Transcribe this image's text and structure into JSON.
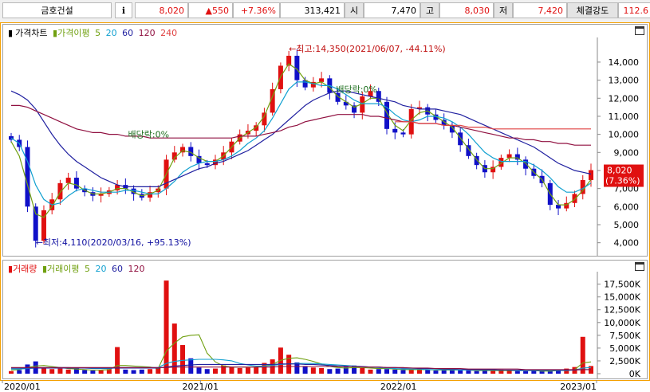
{
  "header": {
    "name": "금호건설",
    "info": "i",
    "price": "8,020",
    "change": "▲550",
    "change_pct": "+7.36%",
    "volume": "313,421",
    "open_label": "시",
    "open": "7,470",
    "high_label": "고",
    "high": "8,030",
    "low_label": "저",
    "low": "7,420",
    "strength_label": "체결강도",
    "strength": "112.6"
  },
  "price_legend": {
    "title": "가격차트",
    "ma_label": "가격이평",
    "ma5": "5",
    "ma20": "20",
    "ma60": "60",
    "ma120": "120",
    "ma240": "240"
  },
  "volume_legend": {
    "title": "거래량",
    "ma_label": "거래이평",
    "ma5": "5",
    "ma20": "20",
    "ma60": "60",
    "ma120": "120"
  },
  "colors": {
    "up": "#e01010",
    "down": "#1010c8",
    "ma5": "#70a010",
    "ma20": "#10a0d0",
    "ma60": "#2020a0",
    "ma120": "#901040",
    "ma240": "#e04040",
    "frame": "#f5a000"
  },
  "chart_data": {
    "type": "candlestick",
    "x_ticks": [
      "2020/01",
      "2021/01",
      "2022/01",
      "2023/01"
    ],
    "price_axis": {
      "ticks": [
        "4,000",
        "5,000",
        "6,000",
        "7,000",
        "8,000",
        "9,000",
        "10,000",
        "11,000",
        "12,000",
        "13,000",
        "14,000"
      ],
      "ylim": [
        3500,
        15100
      ]
    },
    "volume_axis": {
      "ticks": [
        "0K",
        "2,500K",
        "5,000K",
        "7,500K",
        "10,000K",
        "12,500K",
        "15,000K",
        "17,500K"
      ],
      "ylim": [
        0,
        19000
      ]
    },
    "annotations": {
      "high": "최고:14,350(2021/06/07, -44.11%)",
      "low": "최저:4,110(2020/03/16, +95.13%)",
      "dividend1": "배당락:0%",
      "dividend2": "배당락:0%",
      "current_price": "8,020",
      "current_pct": "(7.36%)"
    },
    "series": [
      {
        "name": "가격차트",
        "values": [
          9700,
          9300,
          6000,
          4110,
          5800,
          6400,
          7300,
          7600,
          7000,
          6800,
          6600,
          6700,
          6900,
          7200,
          7000,
          6700,
          6500,
          6800,
          7000,
          8600,
          9000,
          9300,
          8800,
          8400,
          8300,
          8600,
          9000,
          9600,
          10000,
          10200,
          10500,
          11200,
          12500,
          13800,
          14350,
          13000,
          12600,
          12900,
          13100,
          12300,
          11800,
          11600,
          11200,
          12100,
          12400,
          11800,
          10300,
          10100,
          10000,
          11400,
          11500,
          11100,
          10800,
          10500,
          10100,
          9400,
          8800,
          8300,
          7900,
          8200,
          8700,
          8900,
          8600,
          8100,
          7700,
          7300,
          6100,
          5900,
          6200,
          6700,
          7470,
          8020
        ]
      },
      {
        "name": "5",
        "values": [
          9600,
          8800,
          7200,
          5600,
          5400,
          6000,
          6800,
          7300,
          7200,
          6900,
          6700,
          6700,
          6800,
          7000,
          7000,
          6800,
          6600,
          6700,
          6900,
          7800,
          8700,
          9100,
          9000,
          8700,
          8500,
          8500,
          8800,
          9300,
          9800,
          10100,
          10400,
          11000,
          12100,
          13200,
          13900,
          13600,
          13000,
          12800,
          12900,
          12600,
          12100,
          11800,
          11500,
          11700,
          12000,
          12000,
          11200,
          10500,
          10200,
          10800,
          11200,
          11300,
          11000,
          10700,
          10400,
          9800,
          9200,
          8600,
          8100,
          8100,
          8400,
          8700,
          8700,
          8400,
          7900,
          7500,
          6700,
          6100,
          6100,
          6400,
          6900,
          7500
        ]
      },
      {
        "name": "20",
        "values": [
          9800,
          9500,
          8500,
          7200,
          6400,
          6100,
          6200,
          6600,
          6900,
          7000,
          6900,
          6800,
          6800,
          6800,
          6900,
          6900,
          6800,
          6700,
          6700,
          7000,
          7400,
          7900,
          8200,
          8400,
          8500,
          8500,
          8600,
          8800,
          9100,
          9500,
          9800,
          10200,
          10900,
          11700,
          12500,
          12900,
          12900,
          12800,
          12700,
          12700,
          12500,
          12200,
          11900,
          11700,
          11700,
          11700,
          11500,
          11100,
          10800,
          10700,
          10800,
          11000,
          11000,
          10900,
          10700,
          10400,
          10000,
          9500,
          9000,
          8700,
          8500,
          8500,
          8500,
          8500,
          8300,
          8000,
          7600,
          7100,
          6800,
          6800,
          7000,
          7300
        ]
      },
      {
        "name": "60",
        "values": [
          12400,
          12200,
          11900,
          11400,
          10700,
          10000,
          9400,
          8900,
          8500,
          8200,
          7900,
          7600,
          7400,
          7200,
          7100,
          7100,
          7100,
          7100,
          7100,
          7300,
          7500,
          7700,
          7900,
          8100,
          8200,
          8400,
          8500,
          8700,
          8900,
          9100,
          9400,
          9700,
          10000,
          10400,
          10800,
          11200,
          11600,
          11900,
          12100,
          12300,
          12400,
          12400,
          12300,
          12200,
          12100,
          12000,
          11900,
          11800,
          11600,
          11500,
          11400,
          11400,
          11400,
          11300,
          11200,
          11100,
          10900,
          10700,
          10500,
          10300,
          10100,
          9900,
          9700,
          9500,
          9300,
          9000,
          8700,
          8400,
          8200,
          8000,
          7900,
          7800
        ]
      },
      {
        "name": "120",
        "values": [
          11600,
          11600,
          11500,
          11300,
          11100,
          10900,
          10700,
          10500,
          10300,
          10200,
          10100,
          10100,
          10000,
          10000,
          9900,
          9900,
          9900,
          9800,
          9800,
          9800,
          9800,
          9800,
          9800,
          9800,
          9800,
          9800,
          9800,
          9800,
          9900,
          9900,
          9900,
          10000,
          10100,
          10200,
          10400,
          10500,
          10700,
          10800,
          10900,
          11000,
          11100,
          11100,
          11100,
          11100,
          11000,
          11000,
          10900,
          10800,
          10700,
          10700,
          10600,
          10600,
          10600,
          10500,
          10500,
          10400,
          10300,
          10200,
          10100,
          10000,
          9900,
          9800,
          9800,
          9700,
          9700,
          9600,
          9600,
          9500,
          9500,
          9400,
          9400,
          9400
        ]
      },
      {
        "name": "240",
        "values": [
          10700,
          10700,
          10700,
          10600,
          10600,
          10600,
          10500,
          10500,
          10500,
          10400,
          10400,
          10400,
          10300,
          10300,
          10300,
          10300,
          10300,
          10300,
          10300,
          10300,
          10300,
          10300,
          10300,
          10300,
          10300
        ]
      }
    ],
    "volume_values_k": [
      500,
      700,
      1800,
      2400,
      1200,
      900,
      1000,
      800,
      1000,
      700,
      600,
      650,
      900,
      5200,
      800,
      700,
      800,
      900,
      1200,
      18200,
      9800,
      5600,
      3000,
      1200,
      900,
      1000,
      1600,
      1300,
      1100,
      1200,
      1300,
      2100,
      2800,
      5100,
      3700,
      2200,
      1500,
      1200,
      1100,
      900,
      1000,
      1300,
      1600,
      1100,
      800,
      900,
      900,
      800,
      700,
      900,
      800,
      700,
      600,
      700,
      800,
      700,
      600,
      500,
      600,
      700,
      800,
      600,
      500,
      500,
      600,
      500,
      600,
      700,
      1000,
      1300,
      7200,
      1500
    ],
    "volume_ma_k": [
      {
        "name": "5",
        "values": [
          700,
          800,
          1200,
          1500,
          1600,
          1400,
          1200,
          1000,
          900,
          800,
          700,
          700,
          800,
          1600,
          1600,
          1500,
          1400,
          1300,
          1000,
          4400,
          6000,
          7200,
          7500,
          7600,
          4000,
          2300,
          1500,
          1300,
          1300,
          1300,
          1300,
          1500,
          1800,
          2600,
          3000,
          3100,
          2800,
          2400,
          1900,
          1400,
          1200,
          1100,
          1200,
          1200,
          1100,
          1000,
          1000,
          900,
          800,
          800,
          800,
          800,
          700,
          700,
          700,
          700,
          700,
          600,
          600,
          600,
          600,
          600,
          600,
          600,
          600,
          500,
          500,
          600,
          700,
          800,
          2100,
          2300
        ]
      },
      {
        "name": "20",
        "values": [
          900,
          900,
          1000,
          1100,
          1200,
          1200,
          1200,
          1200,
          1100,
          1100,
          1000,
          1000,
          1000,
          1200,
          1200,
          1200,
          1200,
          1200,
          1200,
          2000,
          2400,
          2600,
          2700,
          2800,
          2800,
          2800,
          2700,
          2500,
          2000,
          1700,
          1500,
          1500,
          1600,
          1800,
          1900,
          2000,
          2000,
          2000,
          1900,
          1800,
          1700,
          1600,
          1500,
          1400,
          1300,
          1200,
          1100,
          1000,
          900,
          900,
          900,
          800,
          800,
          800,
          800,
          700,
          700,
          700,
          700,
          700,
          700,
          700,
          600,
          600,
          600,
          600,
          600,
          600,
          600,
          700,
          1100,
          1200
        ]
      },
      {
        "name": "60",
        "values": [
          1100,
          1100,
          1100,
          1100,
          1100,
          1100,
          1100,
          1100,
          1100,
          1100,
          1100,
          1100,
          1100,
          1100,
          1100,
          1100,
          1100,
          1100,
          1100,
          1300,
          1500,
          1600,
          1700,
          1800,
          1800,
          1800,
          1800,
          1800,
          1800,
          1800,
          1800,
          1800,
          1800,
          1900,
          1900,
          1900,
          1800,
          1800,
          1700,
          1600,
          1500,
          1500,
          1400,
          1400,
          1300,
          1300,
          1200,
          1200,
          1100,
          1100,
          1000,
          1000,
          1000,
          900,
          900,
          900,
          800,
          800,
          800,
          800,
          700,
          700,
          700,
          700,
          700,
          700,
          700,
          700,
          700,
          700,
          800,
          800
        ]
      },
      {
        "name": "120",
        "values": [
          1200,
          1200,
          1200,
          1200,
          1200,
          1200,
          1200,
          1200,
          1200,
          1200,
          1200,
          1200,
          1200,
          1200,
          1200,
          1200,
          1200,
          1200,
          1200,
          1200,
          1300,
          1300,
          1300,
          1300,
          1300,
          1300,
          1300,
          1300,
          1300,
          1300,
          1300,
          1300,
          1300,
          1400,
          1400,
          1400,
          1400,
          1400,
          1400,
          1400,
          1400,
          1400,
          1400,
          1300,
          1300,
          1300,
          1200,
          1200,
          1200,
          1100,
          1100,
          1100,
          1000,
          1000,
          1000,
          1000,
          900,
          900,
          900,
          900,
          900,
          900,
          900,
          800,
          800,
          800,
          800,
          800,
          800,
          800,
          800,
          800
        ]
      }
    ]
  }
}
